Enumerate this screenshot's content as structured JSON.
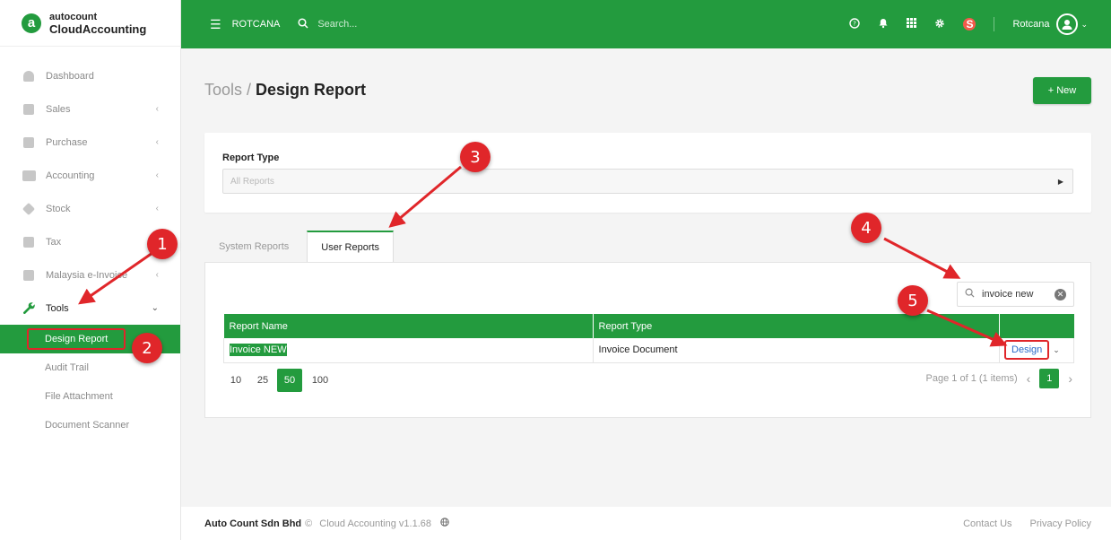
{
  "brand": {
    "logo_letter": "a",
    "line1": "autocount",
    "line2": "CloudAccounting"
  },
  "sidebar": {
    "items": [
      {
        "label": "Dashboard",
        "chevron": ""
      },
      {
        "label": "Sales",
        "chevron": "‹"
      },
      {
        "label": "Purchase",
        "chevron": "‹"
      },
      {
        "label": "Accounting",
        "chevron": "‹"
      },
      {
        "label": "Stock",
        "chevron": "‹"
      },
      {
        "label": "Tax",
        "chevron": ""
      },
      {
        "label": "Malaysia e-Invoice",
        "chevron": "‹"
      },
      {
        "label": "Tools",
        "chevron": "⌄"
      }
    ],
    "subitems": [
      {
        "label": "Design Report"
      },
      {
        "label": "Audit Trail"
      },
      {
        "label": "File Attachment"
      },
      {
        "label": "Document Scanner"
      }
    ]
  },
  "topbar": {
    "company": "ROTCANA",
    "search_placeholder": "Search...",
    "notif_badge": "S",
    "user_name": "Rotcana"
  },
  "page": {
    "breadcrumb_parent": "Tools / ",
    "title": "Design Report",
    "new_button": "+ New"
  },
  "filter": {
    "label": "Report Type",
    "value": "All Reports"
  },
  "tabs": [
    {
      "label": "System Reports"
    },
    {
      "label": "User Reports"
    }
  ],
  "table": {
    "search_value": "invoice new",
    "columns": [
      "Report Name",
      "Report Type",
      ""
    ],
    "rows": [
      {
        "name": "Invoice NEW",
        "type": "Invoice Document",
        "action": "Design"
      }
    ]
  },
  "pager": {
    "sizes": [
      "10",
      "25",
      "50",
      "100"
    ],
    "active_size": "50",
    "summary": "Page 1 of 1 (1 items)",
    "current_page": "1"
  },
  "footer": {
    "company": "Auto Count Sdn Bhd",
    "copyright": "©",
    "version": "Cloud Accounting v1.1.68",
    "links": [
      "Contact Us",
      "Privacy Policy"
    ]
  },
  "annotations": [
    "1",
    "2",
    "3",
    "4",
    "5"
  ],
  "colors": {
    "brand_green": "#239b3e",
    "annotation_red": "#e0262a"
  }
}
